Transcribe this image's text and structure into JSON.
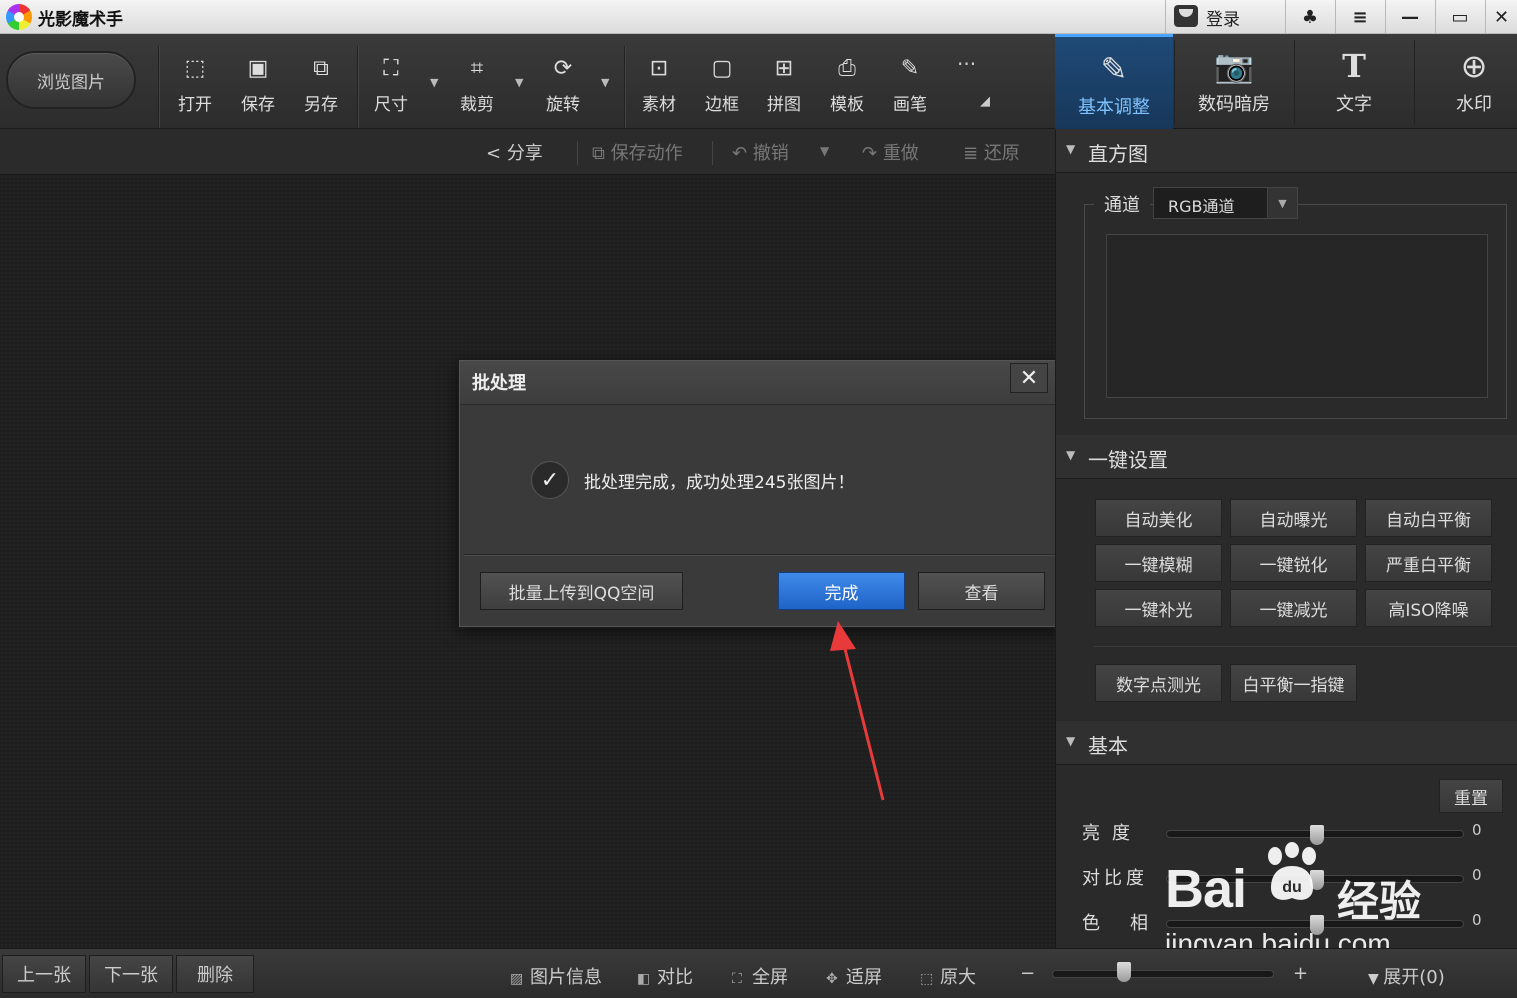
{
  "app": {
    "title": "光影魔术手",
    "login": "登录"
  },
  "window_controls": [
    "shirt-icon",
    "menu-icon",
    "minimize-icon",
    "maximize-icon",
    "close-icon"
  ],
  "toolbar": {
    "browse": "浏览图片",
    "tools": [
      {
        "label": "打开",
        "icon": "open-icon"
      },
      {
        "label": "保存",
        "icon": "save-icon"
      },
      {
        "label": "另存",
        "icon": "save-as-icon"
      },
      {
        "label": "尺寸",
        "icon": "resize-icon"
      },
      {
        "label": "裁剪",
        "icon": "crop-icon"
      },
      {
        "label": "旋转",
        "icon": "rotate-icon"
      },
      {
        "label": "素材",
        "icon": "material-icon"
      },
      {
        "label": "边框",
        "icon": "border-icon"
      },
      {
        "label": "拼图",
        "icon": "collage-icon"
      },
      {
        "label": "模板",
        "icon": "template-icon"
      },
      {
        "label": "画笔",
        "icon": "brush-icon"
      }
    ],
    "more": "···"
  },
  "right_tabs": [
    {
      "label": "基本调整",
      "icon": "edit-icon",
      "active": true
    },
    {
      "label": "数码暗房",
      "icon": "camera-icon",
      "active": false
    },
    {
      "label": "文字",
      "icon": "text-icon",
      "active": false
    },
    {
      "label": "水印",
      "icon": "watermark-icon",
      "active": false
    }
  ],
  "subbar": {
    "share": "分享",
    "save_action": "保存动作",
    "undo": "撤销",
    "redo": "重做",
    "restore": "还原"
  },
  "dialog": {
    "title": "批处理",
    "close": "✕",
    "message": "批处理完成，成功处理245张图片！",
    "upload_button": "批量上传到QQ空间",
    "done_button": "完成",
    "view_button": "查看"
  },
  "panel": {
    "histogram": {
      "title": "直方图",
      "channel_label": "通道",
      "channel_value": "RGB通道"
    },
    "one_click": {
      "title": "一键设置",
      "presets": [
        "自动美化",
        "自动曝光",
        "自动白平衡",
        "一键模糊",
        "一键锐化",
        "严重白平衡",
        "一键补光",
        "一键减光",
        "高ISO降噪"
      ],
      "extra": [
        "数字点测光",
        "白平衡一指键"
      ]
    },
    "basic": {
      "title": "基本",
      "reset": "重置",
      "sliders": [
        {
          "label": "亮度",
          "value": "0"
        },
        {
          "label": "对比度",
          "value": "0"
        },
        {
          "label": "色相",
          "value": "0"
        }
      ]
    }
  },
  "watermark": {
    "brand": "Bai",
    "paw": "du",
    "cn": "经验",
    "url": "jingyan.baidu.com"
  },
  "statusbar": {
    "prev": "上一张",
    "next": "下一张",
    "delete": "删除",
    "info": "图片信息",
    "compare": "对比",
    "fullscreen": "全屏",
    "fit": "适屏",
    "original": "原大",
    "zoom_minus": "−",
    "zoom_plus": "+",
    "expand": "展开(0)"
  }
}
